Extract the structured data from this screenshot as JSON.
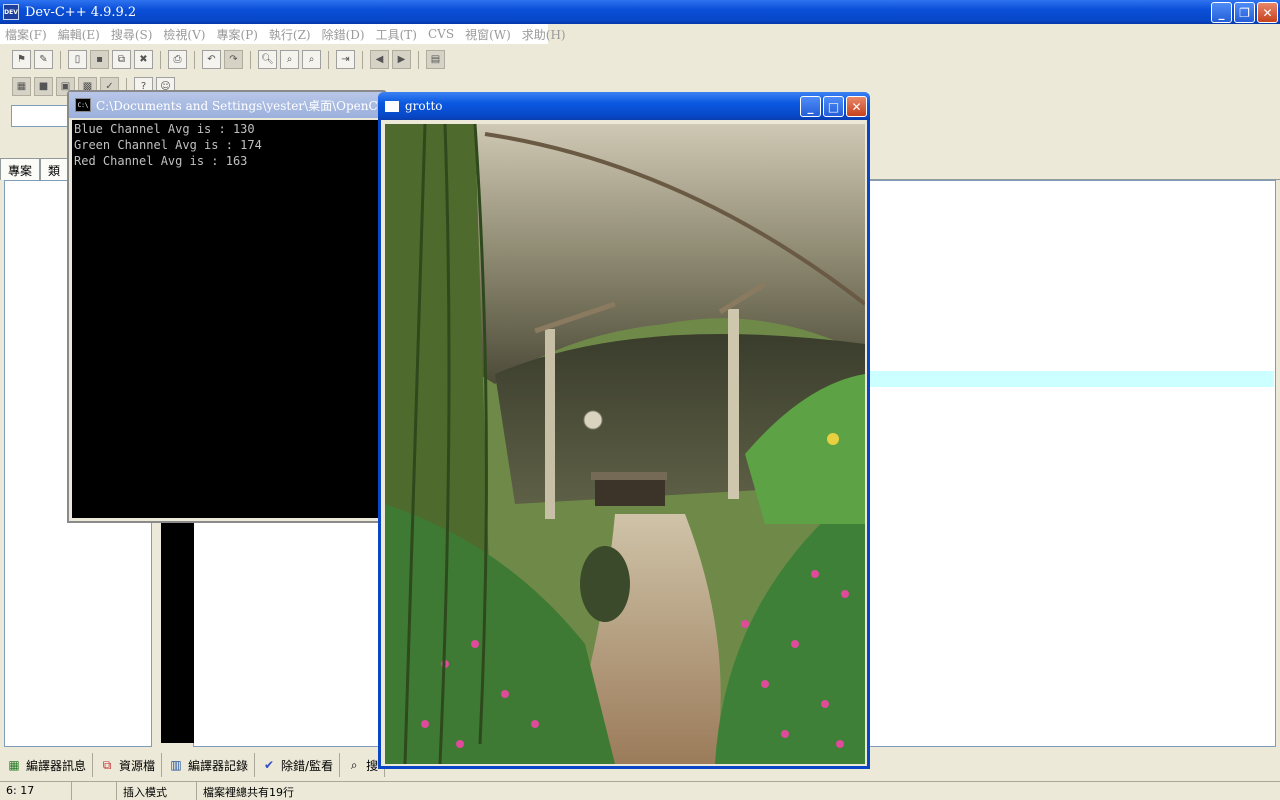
{
  "app": {
    "title": "Dev-C++ 4.9.9.2",
    "icon_text": "DEV"
  },
  "menu": [
    "檔案(F)",
    "編輯(E)",
    "搜尋(S)",
    "檢視(V)",
    "專案(P)",
    "執行(Z)",
    "除錯(D)",
    "工具(T)",
    "CVS",
    "視窗(W)",
    "求助(H)"
  ],
  "left_panel": {
    "tabs": [
      "專案",
      "類"
    ]
  },
  "bottom_tabs": [
    {
      "label": "編譯器訊息",
      "icon": "grid-icon"
    },
    {
      "label": "資源檔",
      "icon": "resources-icon"
    },
    {
      "label": "編譯器記錄",
      "icon": "chart-icon"
    },
    {
      "label": "除錯/監看",
      "icon": "check-icon"
    },
    {
      "label": "搜",
      "icon": "find-icon"
    }
  ],
  "status": {
    "position": "6: 17",
    "blank": "",
    "mode": "插入模式",
    "lines": "檔案裡總共有19行"
  },
  "console": {
    "title": "C:\\Documents and Settings\\yester\\桌面\\OpenCV\\[C",
    "icon_text": "C:\\",
    "lines": [
      "Blue Channel Avg is : 130",
      "Green Channel Avg is : 174",
      "Red Channel Avg is : 163"
    ]
  },
  "image_window": {
    "title": "grotto"
  },
  "colors": {
    "xp_blue": "#0a58e0",
    "highlight_line": "#ccffff",
    "console_bg": "#000000"
  }
}
